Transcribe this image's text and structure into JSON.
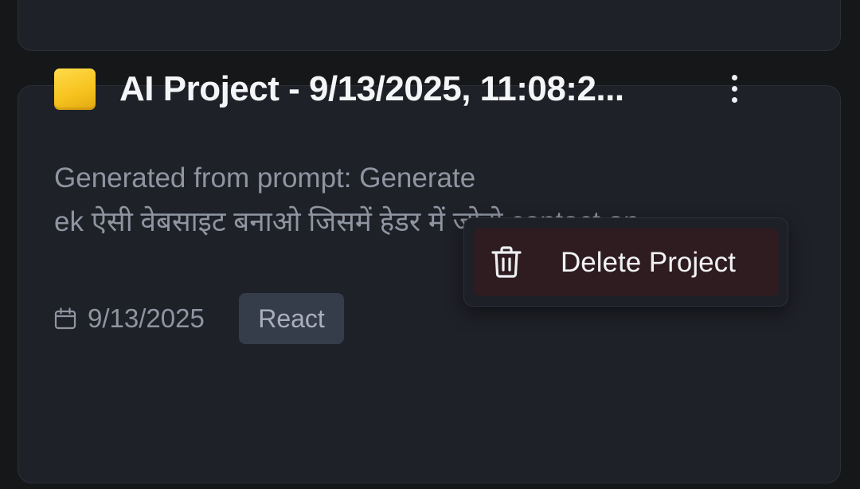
{
  "project_card": {
    "emoji_icon": "yellow-square-icon",
    "title": "AI Project - 9/13/2025, 11:08:2...",
    "description_line1": "Generated from prompt: Generate",
    "description_line2": "ek ऐसी वेबसाइट बनाओ जिसमें हेडर में जोडो contact an...",
    "date": "9/13/2025",
    "tag": "React",
    "menu_icon": "kebab-menu-icon"
  },
  "context_menu": {
    "items": [
      {
        "label": "Delete Project",
        "icon": "trash-icon"
      }
    ]
  },
  "colors": {
    "background": "#161719",
    "card": "#1f2128",
    "menu_danger_bg": "#2f1c20",
    "tag_bg": "#363d4a"
  }
}
